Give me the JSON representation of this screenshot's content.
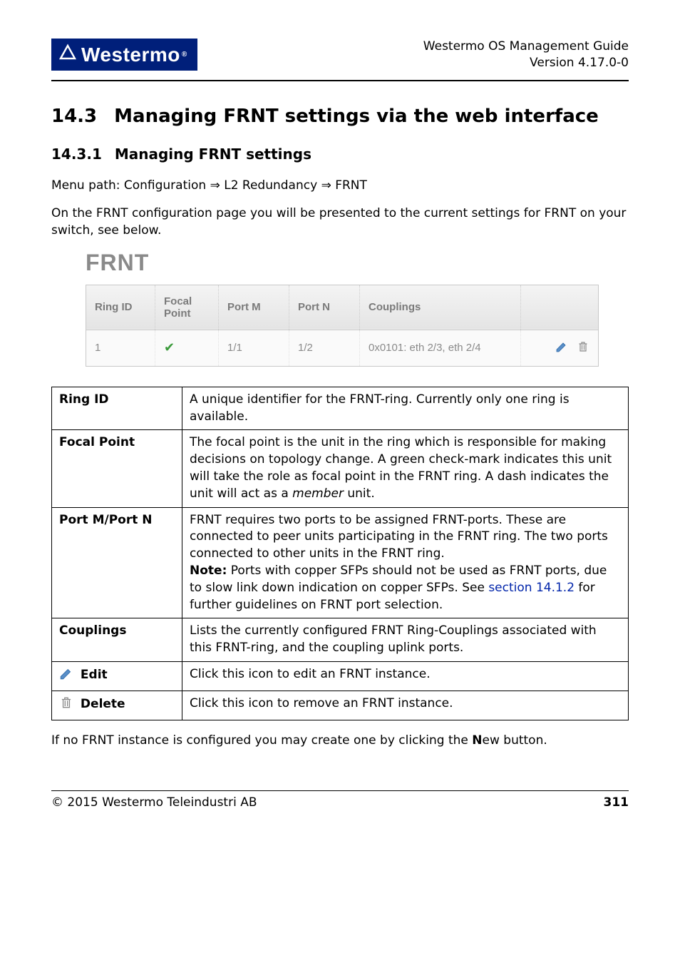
{
  "header": {
    "logo_text": "Westermo",
    "title": "Westermo OS Management Guide",
    "version": "Version 4.17.0-0"
  },
  "section": {
    "number": "14.3",
    "title": "Managing FRNT settings via the web interface"
  },
  "subsection": {
    "number": "14.3.1",
    "title": "Managing FRNT settings"
  },
  "paragraphs": {
    "menu_path_prefix": "Menu path: Configuration ",
    "menu_path_mid": " L2 Redundancy ",
    "menu_path_end": " FRNT",
    "intro": "On the FRNT configuration page you will be presented to the current settings for FRNT on your switch, see below."
  },
  "screenshot": {
    "heading": "FRNT",
    "headers": {
      "ring_id": "Ring ID",
      "focal_point": "Focal Point",
      "port_m": "Port M",
      "port_n": "Port N",
      "couplings": "Couplings"
    },
    "row": {
      "ring_id": "1",
      "port_m": "1/1",
      "port_n": "1/2",
      "couplings": "0x0101: eth 2/3, eth 2/4"
    }
  },
  "definitions": {
    "ring_id": {
      "label": "Ring ID",
      "text": "A unique identifier for the FRNT-ring. Currently only one ring is available."
    },
    "focal_point": {
      "label": "Focal Point",
      "text_a": "The focal point is the unit in the ring which is responsible for making decisions on topology change. A green check-mark indicates this unit will take the role as focal point in the FRNT ring. A dash indicates the unit will act as a ",
      "text_b": "member",
      "text_c": " unit."
    },
    "port_m_n": {
      "label": "Port M/Port N",
      "text_a": "FRNT requires two ports to be assigned FRNT-ports. These are connected to peer units participating in the FRNT ring. The two ports connected to other units in the FRNT ring.",
      "note_label": "Note:",
      "note_text": " Ports with copper SFPs should not be used as FRNT ports, due to slow link down indication on copper SFPs. See ",
      "link_text": "section 14.1.2",
      "note_tail": " for further guidelines on FRNT port selection."
    },
    "couplings": {
      "label": "Couplings",
      "text": "Lists the currently configured FRNT Ring-Couplings associated with this FRNT-ring, and the coupling uplink ports."
    },
    "edit": {
      "label": "Edit",
      "text": "Click this icon to edit an FRNT instance."
    },
    "delete": {
      "label": "Delete",
      "text": "Click this icon to remove an FRNT instance."
    }
  },
  "closing": {
    "pre": "If no FRNT instance is configured you may create one by clicking the ",
    "bold": "N",
    "post": "ew button."
  },
  "footer": {
    "left": "© 2015 Westermo Teleindustri AB",
    "page": "311"
  }
}
